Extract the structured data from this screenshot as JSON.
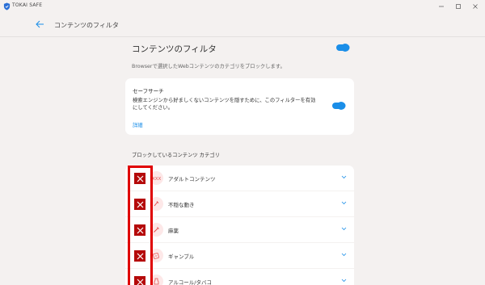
{
  "window": {
    "app_title": "TOKAI SAFE",
    "controls": [
      "minimize-icon",
      "maximize-icon",
      "close-icon"
    ]
  },
  "header": {
    "title": "コンテンツのフィルタ"
  },
  "main": {
    "page_title": "コンテンツのフィルタ",
    "description": "Browserで選択したWebコンテンツのカテゴリをブロックします。",
    "main_toggle_on": true
  },
  "safe_search": {
    "title": "セーフサーチ",
    "text": "検索エンジンから好ましくないコンテンツを隠すために、このフィルターを有効にしてください。",
    "link": "詳細",
    "toggle_on": true
  },
  "blocked_section": {
    "title": "ブロックしているコンテンツ カテゴリ",
    "categories": [
      {
        "label": "アダルトコンテンツ",
        "icon": "adult-icon"
      },
      {
        "label": "不穏な動き",
        "icon": "fist-icon"
      },
      {
        "label": "麻薬",
        "icon": "syringe-icon"
      },
      {
        "label": "ギャンブル",
        "icon": "dice-icon"
      },
      {
        "label": "アルコール/タバコ",
        "icon": "alcohol-icon"
      }
    ]
  },
  "colors": {
    "accent": "#1a8ee8",
    "block_red": "#b50a0a",
    "highlight_red": "#e00000"
  }
}
